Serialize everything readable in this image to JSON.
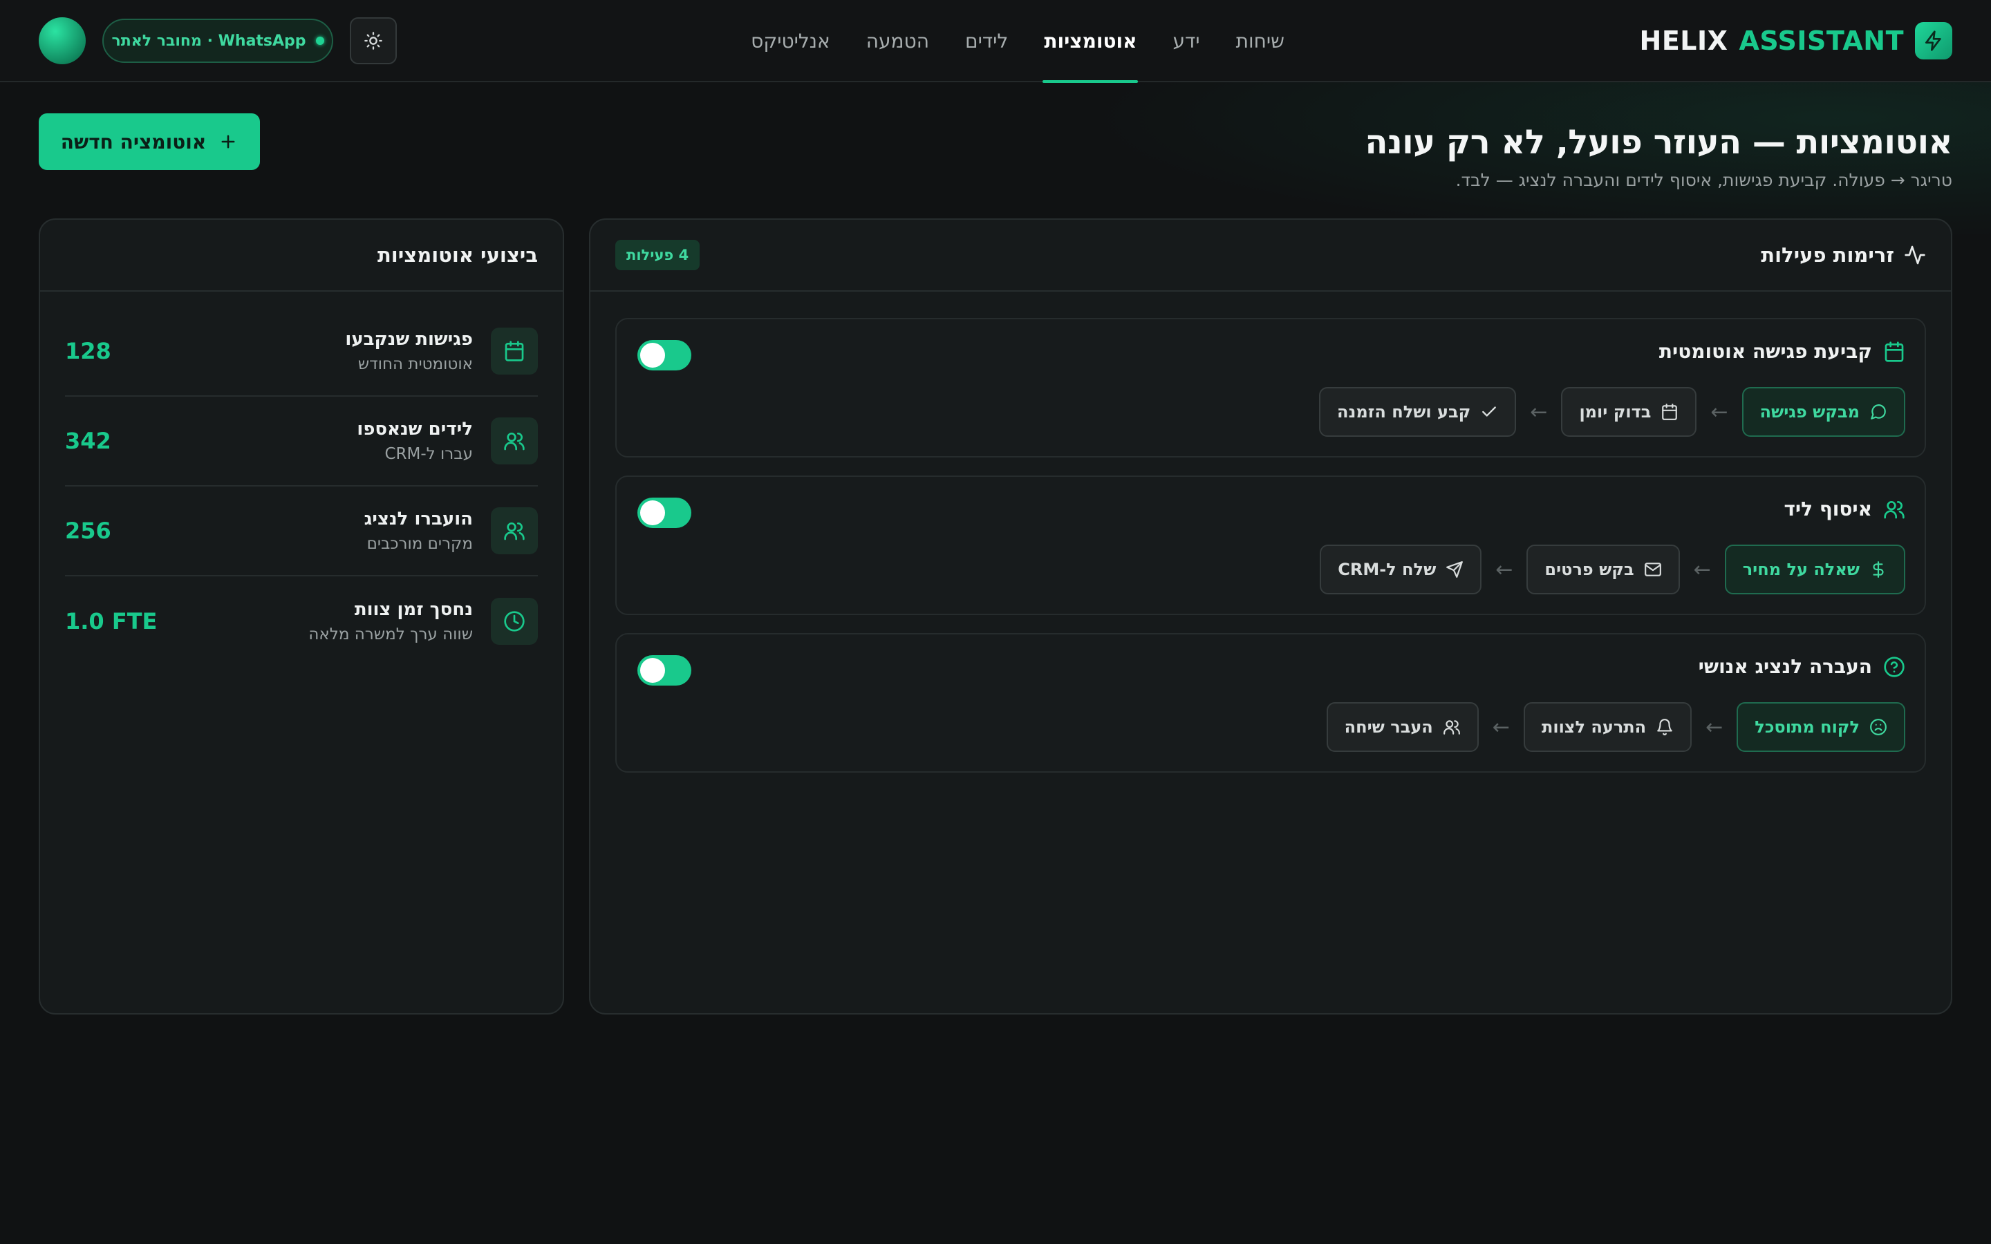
{
  "brand": {
    "word1": "HELIX",
    "word2": "ASSISTANT",
    "icon": "lightning-icon",
    "accent": "#19c98c"
  },
  "nav": {
    "items": [
      {
        "label": "שיחות",
        "active": false
      },
      {
        "label": "ידע",
        "active": false
      },
      {
        "label": "אוטומציות",
        "active": true
      },
      {
        "label": "לידים",
        "active": false
      },
      {
        "label": "הטמעה",
        "active": false
      },
      {
        "label": "אנליטיקס",
        "active": false
      }
    ]
  },
  "header": {
    "status_label": "WhatsApp · מחובר לאתר",
    "theme_icon": "sun-icon"
  },
  "hero": {
    "title": "אוטומציות — העוזר פועל, לא רק עונה",
    "subtitle": "טריגר → פעולה. קביעת פגישות, איסוף לידים והעברה לנציג — לבד.",
    "new_button": "אוטומציה חדשה"
  },
  "flows": {
    "title": "זרימות פעילות",
    "count_badge": "4 פעילות",
    "items": [
      {
        "title": "קביעת פגישה אוטומטית",
        "icon": "calendar-icon",
        "enabled": true,
        "steps": [
          {
            "label": "מבקש פגישה",
            "icon": "chat-bubble-icon"
          },
          {
            "label": "בדוק יומן",
            "icon": "calendar-icon"
          },
          {
            "label": "קבע ושלח הזמנה",
            "icon": "check-icon"
          }
        ]
      },
      {
        "title": "איסוף ליד",
        "icon": "users-icon",
        "enabled": true,
        "steps": [
          {
            "label": "שאלה על מחיר",
            "icon": "dollar-icon"
          },
          {
            "label": "בקש פרטים",
            "icon": "mail-icon"
          },
          {
            "label": "שלח ל-CRM",
            "icon": "send-icon"
          }
        ]
      },
      {
        "title": "העברה לנציג אנושי",
        "icon": "help-circle-icon",
        "enabled": true,
        "steps": [
          {
            "label": "לקוח מתוסכל",
            "icon": "frown-icon"
          },
          {
            "label": "התרעה לצוות",
            "icon": "bell-icon"
          },
          {
            "label": "העבר שיחה",
            "icon": "users-icon"
          }
        ]
      }
    ],
    "arrow": "←"
  },
  "stats": {
    "title": "ביצועי אוטומציות",
    "items": [
      {
        "label": "פגישות שנקבעו",
        "sub": "אוטומטית החודש",
        "value": "128",
        "icon": "calendar-icon"
      },
      {
        "label": "לידים שנאספו",
        "sub": "עברו ל-CRM",
        "value": "342",
        "icon": "users-icon"
      },
      {
        "label": "הועברו לנציג",
        "sub": "מקרים מורכבים",
        "value": "256",
        "icon": "users-icon"
      },
      {
        "label": "נחסך זמן צוות",
        "sub": "שווה ערך למשרה מלאה",
        "value": "1.0 FTE",
        "icon": "clock-icon"
      }
    ]
  }
}
